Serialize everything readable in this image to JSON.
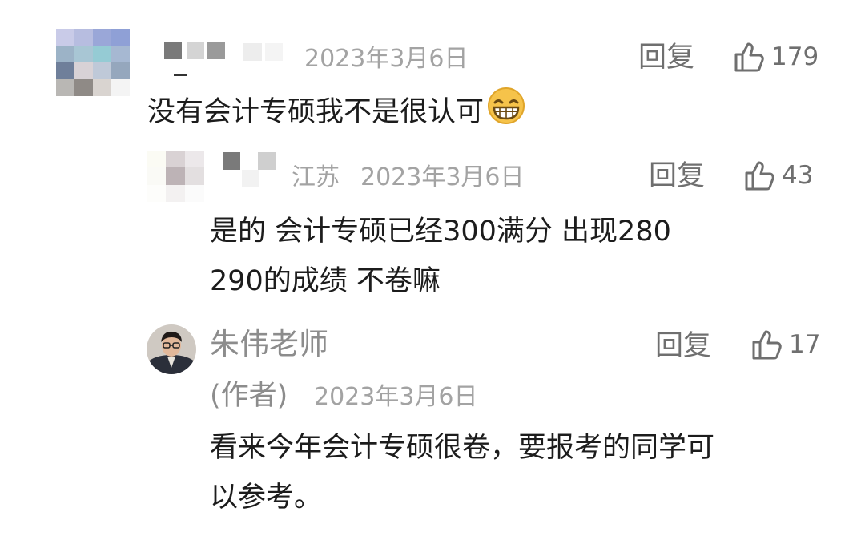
{
  "comment1": {
    "location": "",
    "date": "2023年3月6日",
    "reply_label": "回复",
    "likes": "179",
    "text": "没有会计专硕我不是很认可",
    "emoji_icon": "grinning-face-emoji"
  },
  "comment2": {
    "location": "江苏",
    "date": "2023年3月6日",
    "reply_label": "回复",
    "likes": "43",
    "text_line1": "是的 会计专硕已经300满分 出现280",
    "text_line2": "290的成绩 不卷嘛"
  },
  "comment3": {
    "username": "朱伟老师",
    "author_tag": "(作者)",
    "date": "2023年3月6日",
    "reply_label": "回复",
    "likes": "17",
    "text_line1": "看来今年会计专硕很卷，要报考的同学可",
    "text_line2": "以参考。"
  },
  "colors": {
    "meta_gray": "#a3a3a3",
    "text": "#1c1c1c",
    "action_gray": "#6f6f6f"
  }
}
